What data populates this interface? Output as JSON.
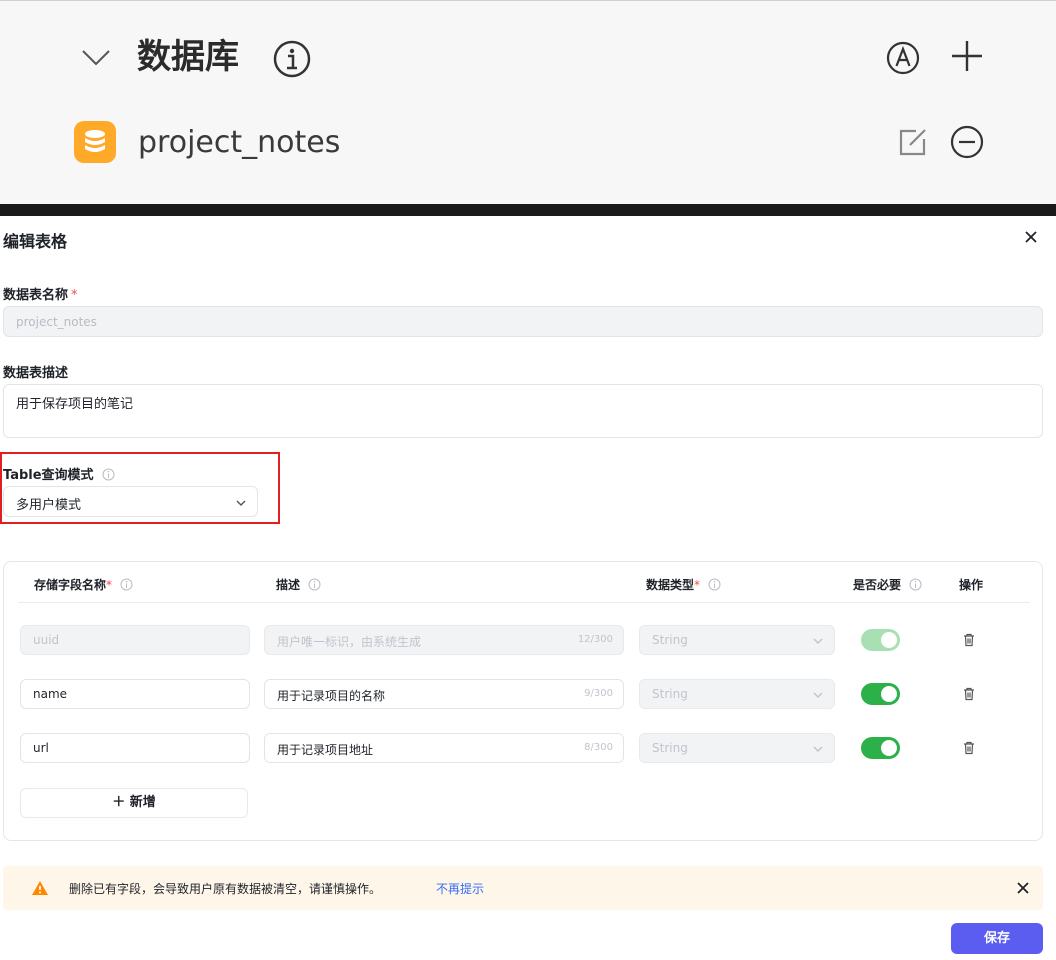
{
  "top": {
    "section_title": "数据库",
    "database_name": "project_notes",
    "icons": [
      "chevron-down-icon",
      "info-icon",
      "auto-icon",
      "plus-icon",
      "database-icon",
      "edit-icon",
      "minus-circle-icon"
    ]
  },
  "modal": {
    "title": "编辑表格",
    "table_name_label": "数据表名称",
    "required_mark": "*",
    "table_name_value": "project_notes",
    "table_desc_label": "数据表描述",
    "table_desc_value": "用于保存项目的笔记",
    "query_mode_label": "Table查询模式",
    "query_mode_value": "多用户模式",
    "columns": {
      "field_name": "存储字段名称",
      "description": "描述",
      "data_type": "数据类型",
      "required": "是否必要",
      "actions": "操作"
    },
    "rows": [
      {
        "name": "uuid",
        "desc": "用户唯一标识，由系统生成",
        "count": "12/300",
        "type": "String",
        "required": true,
        "disabled": true
      },
      {
        "name": "name",
        "desc": "用于记录项目的名称",
        "count": "9/300",
        "type": "String",
        "required": true,
        "disabled": false
      },
      {
        "name": "url",
        "desc": "用于记录项目地址",
        "count": "8/300",
        "type": "String",
        "required": true,
        "disabled": false
      }
    ],
    "add_button": "＋ 新增",
    "warning_text": "删除已有字段，会导致用户原有数据被清空，请谨慎操作。",
    "warning_link": "不再提示",
    "save_button": "保存"
  },
  "colors": {
    "accent": "#5b5cf0",
    "toggle_on": "#2cb14a",
    "warning_bg": "#fff6ea",
    "link": "#336df4",
    "db_badge": "#ffa928",
    "highlight_box": "#e02020"
  }
}
